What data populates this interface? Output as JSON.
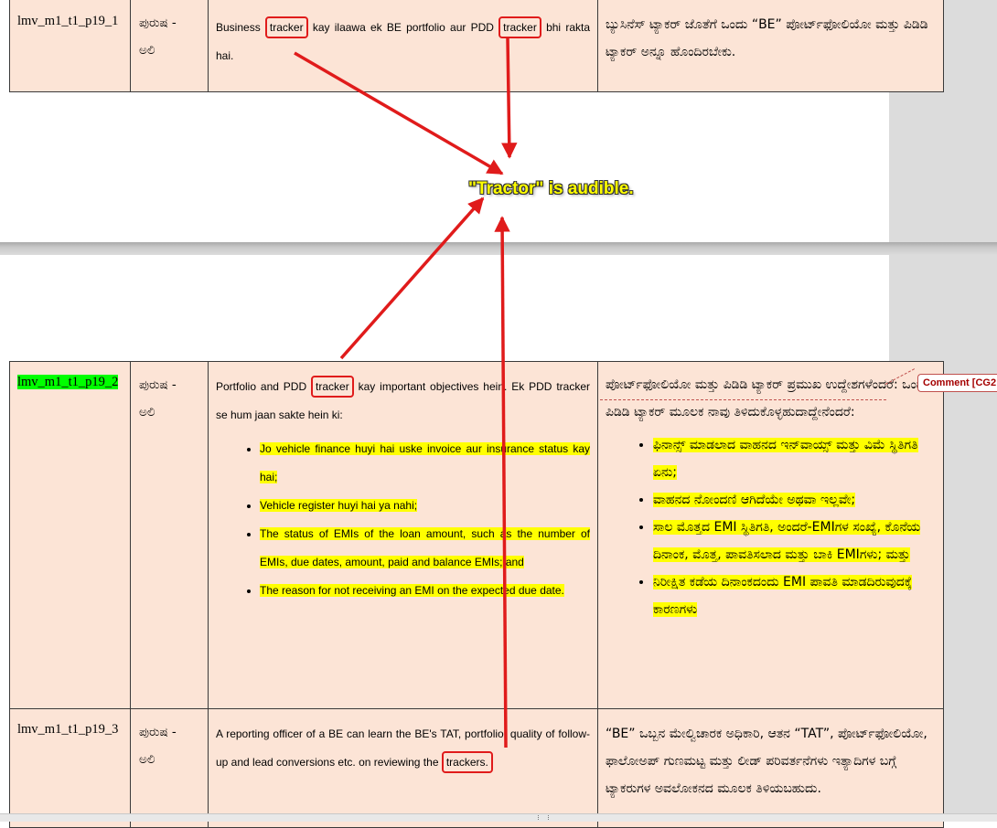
{
  "caption": "\"Tractor\" is audible.",
  "comment_label": "Comment [CG2",
  "rows": [
    {
      "id": "lmv_m1_t1_p19_1",
      "speaker_line1": "ಪುರುಷ -",
      "speaker_line2": "ಅಲಿ",
      "en_part1": "Business ",
      "en_tok1": "tracker",
      "en_part2": " kay ilaawa ek BE portfolio aur PDD ",
      "en_tok2": "tracker",
      "en_part3": " bhi rakta hai.",
      "kn_text": "ಬ್ಯುಸಿನೆಸ್ ಟ್ಯಾಕರ್ ಜೊತೆಗೆ ಒಂದು “BE” ಪೋರ್ಟ್‌ಫೋಲಿಯೋ ಮತ್ತು ಪಿಡಿಡಿ ಟ್ಯಾಕರ್ ಅನ್ನೂ ಹೊಂದಿರಬೇಕು."
    },
    {
      "id": "lmv_m1_t1_p19_2",
      "speaker_line1": "ಪುರುಷ -",
      "speaker_line2": "ಅಲಿ",
      "en_part1": "Portfolio and PDD ",
      "en_tok1": "tracker",
      "en_part2": " kay important objectives hein. Ek PDD tracker se hum jaan sakte hein ki:",
      "en_bullets": [
        "Jo vehicle finance huyi hai uske invoice aur insurance status kay hai;",
        "Vehicle register huyi hai ya nahi;",
        "The status of EMIs of the loan amount, such as the number of EMIs, due dates, amount, paid and balance EMIs; and",
        "The reason for not receiving an EMI on the expected due date."
      ],
      "kn_text": "ಪೋರ್ಟ್‌ಫೋಲಿಯೋ ಮತ್ತು ಪಿಡಿಡಿ ಟ್ಯಾಕರ್ ಪ್ರಮುಖ ಉದ್ದೇಶಗಳೆಂದರೆ: ಒಂದು ಪಿಡಿಡಿ ಟ್ಯಾಕರ್ ಮೂಲಕ ನಾವು ತಿಳಿದುಕೊಳ್ಳಹುದಾದ್ದೇನೆಂದರೆ:",
      "kn_bullets": [
        "ಫಿನಾನ್ಸ್ ಮಾಡಲಾದ ವಾಹನದ ಇನ್‌ವಾಯ್ಸ್ ಮತ್ತು ವಿಮೆ ಸ್ಥಿತಿಗತಿ ಏನು;",
        "ವಾಹನದ ನೋಂದಣಿ ಆಗಿದೆಯೇ ಅಥವಾ ಇಲ್ಲವೇ;",
        "ಸಾಲ ಮೊತ್ತದ EMI ಸ್ಥಿತಿಗತಿ, ಅಂದರೆ-EMIಗಳ ಸಂಖ್ಯೆ, ಕೊನೆಯ ದಿನಾಂಕ, ಮೊತ್ತ, ಪಾವತಿಸಲಾದ ಮತ್ತು ಬಾಕಿ EMIಗಳು; ಮತ್ತು",
        "ನಿರೀಕ್ಷಿತ ಕಡೆಯ ದಿನಾಂಕದಂದು EMI ಪಾವತಿ ಮಾಡದಿರುವುದಕ್ಕೆ ಕಾರಣಗಳು"
      ]
    },
    {
      "id": "lmv_m1_t1_p19_3",
      "speaker_line1": "ಪುರುಷ -",
      "speaker_line2": "ಅಲಿ",
      "en_part1": "A reporting officer of a BE can learn the BE's TAT, portfolio, quality of follow-up and lead conversions etc. on reviewing the ",
      "en_tok1": "trackers.",
      "kn_text": "“BE” ಒಬ್ಬನ ಮೇಲ್ವಿಚಾರಕ ಅಧಿಕಾರಿ, ಆತನ “TAT”, ಪೋರ್ಟ್‌ಫೋಲಿಯೋ, ಫಾಲೋಅಪ್ ಗುಣಮಟ್ಟ ಮತ್ತು ಲೀಡ್ ಪರಿವರ್ತನೆಗಳು ಇತ್ಯಾದಿಗಳ ಬಗ್ಗೆ ಟ್ಯಾಕರುಗಳ ಅವಲೋಕನದ ಮೂಲಕ ತಿಳಿಯಬಹುದು."
    }
  ],
  "colors": {
    "annotation_red": "#e01b1b",
    "highlight_yellow": "#ffff00",
    "highlight_green": "#00ff00",
    "cell_bg": "#fce4d6"
  }
}
